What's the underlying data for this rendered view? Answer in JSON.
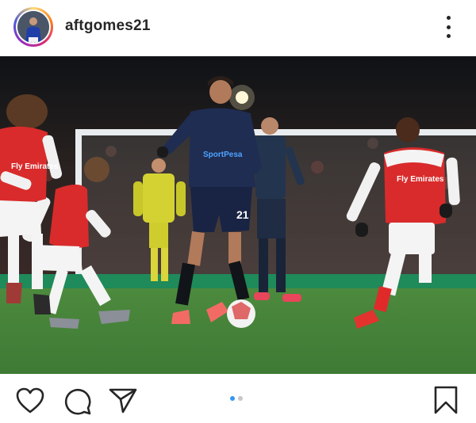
{
  "post": {
    "author": {
      "username": "aftgomes21"
    },
    "photo": {
      "home_shirt_text": "Fly Emirates",
      "away_shirt_sponsor": "SportPesa",
      "away_shirt_number": "21"
    },
    "carousel": {
      "total": 2,
      "current": 1
    },
    "icons": {
      "more": "more-options-icon",
      "like": "heart-icon",
      "comment": "comment-icon",
      "share": "paper-plane-icon",
      "save": "bookmark-icon"
    },
    "colors": {
      "carousel_active": "#3897f0",
      "carousel_inactive": "#c7c7c7",
      "avatar_ring": [
        "#feda75",
        "#fa7e1e",
        "#d62976",
        "#962fbf",
        "#4f5bd5"
      ]
    }
  }
}
